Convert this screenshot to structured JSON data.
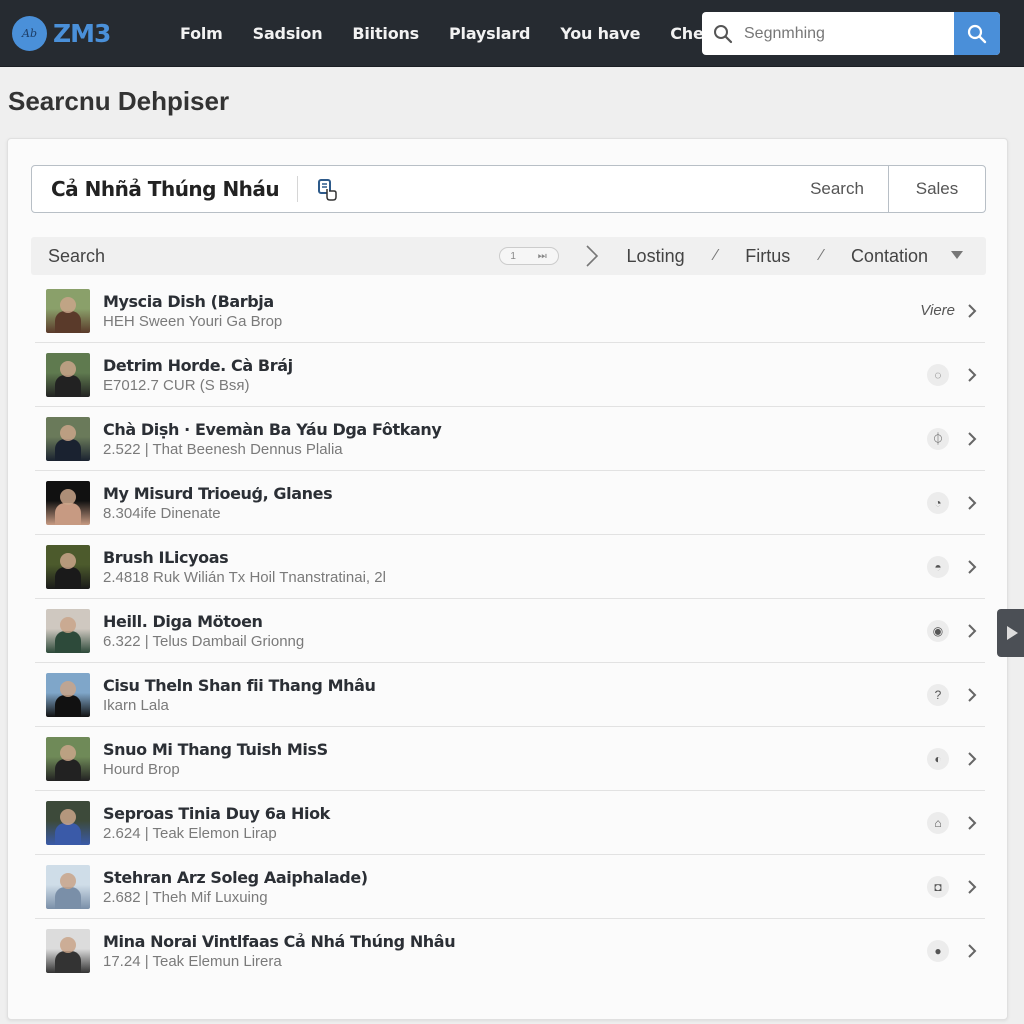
{
  "navbar": {
    "logo_text": "ZM3",
    "logo_badge_text": "Ab",
    "links": [
      "Folm",
      "Sadsion",
      "Biitions",
      "Playslard",
      "You have",
      "Checkly"
    ],
    "search_placeholder": "Segnmhing"
  },
  "page": {
    "title": "Searcnu Dehpiser"
  },
  "query": {
    "value": "Cả Nhñả Thúng Nháu",
    "search_button": "Search",
    "sales_button": "Sales"
  },
  "filters": {
    "label": "Search",
    "page_number": "1",
    "page_skip": "⏭",
    "items": [
      "Losting",
      "Firtus",
      "Contation"
    ],
    "separator": "⁄"
  },
  "results": [
    {
      "title": "Myscia Dish (Barbja",
      "subtitle": "HEH Sween Youri Ga Brop",
      "action": "Viere",
      "action_icon": "text",
      "thumb": [
        "#8aa06a",
        "#5a3a2a"
      ]
    },
    {
      "title": "Detrim Horde. Cà Bráj",
      "subtitle": "E7012.7 CUR (S Bsя)",
      "action_icon": "bucket-icon",
      "glyph": "◌",
      "thumb": [
        "#5f7a4f",
        "#222"
      ]
    },
    {
      "title": "Chà Diṣh · Evemàn Ba Yáu Dga Fôtkany",
      "subtitle": "2.522 | That Beenesh Dennus Plalia",
      "action_icon": "power-icon",
      "glyph": "⏀",
      "thumb": [
        "#6a7a5a",
        "#1a2230"
      ]
    },
    {
      "title": "My Misurd Trioeuģ, Glanes",
      "subtitle": "8.304ife Dinenate",
      "action_icon": "spinner-icon",
      "glyph": "◔",
      "thumb": [
        "#111",
        "#c79a82"
      ]
    },
    {
      "title": "Brush ILicyoas",
      "subtitle": "2.4818 Ruk Wilián Tx Hoil Tnanstratinai, 2l",
      "action_icon": "umbrella-icon",
      "glyph": "◓",
      "thumb": [
        "#4c5a2c",
        "#1a1a1a"
      ]
    },
    {
      "title": "Heill. Diga Mötoen",
      "subtitle": "6.322 | Telus Dambail Grionng",
      "action_icon": "lock-icon",
      "glyph": "◉",
      "thumb": [
        "#cfc8c0",
        "#2d4a3a"
      ]
    },
    {
      "title": "Cisu Theln Shan fii Thang Mhâu",
      "subtitle": "Ikarn Lala",
      "action_icon": "question-icon",
      "glyph": "?",
      "thumb": [
        "#7fa6c9",
        "#111"
      ]
    },
    {
      "title": "Snuo Mi Thang Tuish MisS",
      "subtitle": "Hourd Brop",
      "action_icon": "half-circle-icon",
      "glyph": "◐",
      "thumb": [
        "#6f8a58",
        "#222"
      ]
    },
    {
      "title": "Seproas Tinia Duy 6a Hiok",
      "subtitle": "2.624 | Teak Elemon Lirap",
      "action_icon": "tent-icon",
      "glyph": "⌂",
      "thumb": [
        "#3d4a3a",
        "#3a5aa8"
      ]
    },
    {
      "title": "Stehran Arz Soleg Aaiphalade)",
      "subtitle": "2.682 | Theh Mif Luxuing",
      "action_icon": "bag-icon",
      "glyph": "◘",
      "thumb": [
        "#cfdde8",
        "#7a8fa8"
      ]
    },
    {
      "title": "Mina Norai Vintlfaas Cả Nhá Thúng Nhâu",
      "subtitle": "17.24 | Teak Elemun Lirera",
      "action_icon": "person-icon",
      "glyph": "●",
      "thumb": [
        "#dcdcdc",
        "#333"
      ]
    }
  ],
  "colors": {
    "navbar_bg": "#262b31",
    "accent": "#4a8fd9"
  }
}
